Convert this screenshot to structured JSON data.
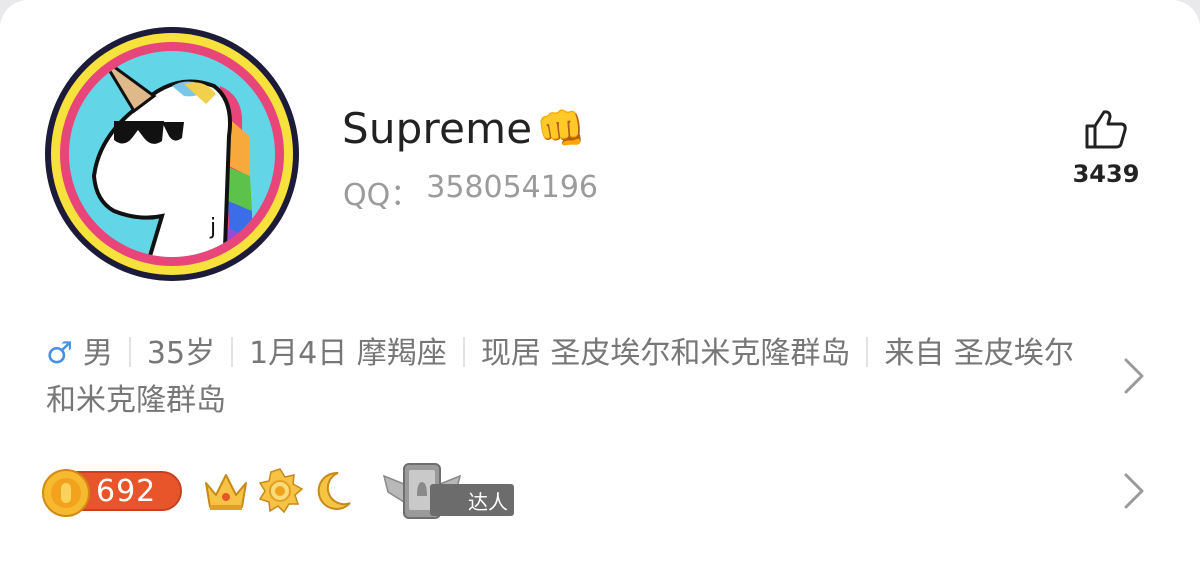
{
  "profile": {
    "name": "Supreme",
    "name_emoji": "👊",
    "qq_label": "QQ：",
    "qq_number": "358054196"
  },
  "like": {
    "icon": "thumbs-up-icon",
    "count": "3439"
  },
  "info": {
    "gender_symbol": "♂",
    "gender": "男",
    "age": "35岁",
    "birthday": "1月4日 摩羯座",
    "residence": "现居 圣皮埃尔和米克隆群岛",
    "hometown": "来自 圣皮埃尔和米克隆群岛"
  },
  "badges": {
    "coin_count": "692",
    "level_icons": [
      "crown-icon",
      "sun-icon",
      "moon-icon"
    ],
    "expert_label": "达人"
  },
  "colors": {
    "accent_blue": "#4a90e2",
    "coin_red": "#e8552a",
    "text_gray": "#777777"
  }
}
